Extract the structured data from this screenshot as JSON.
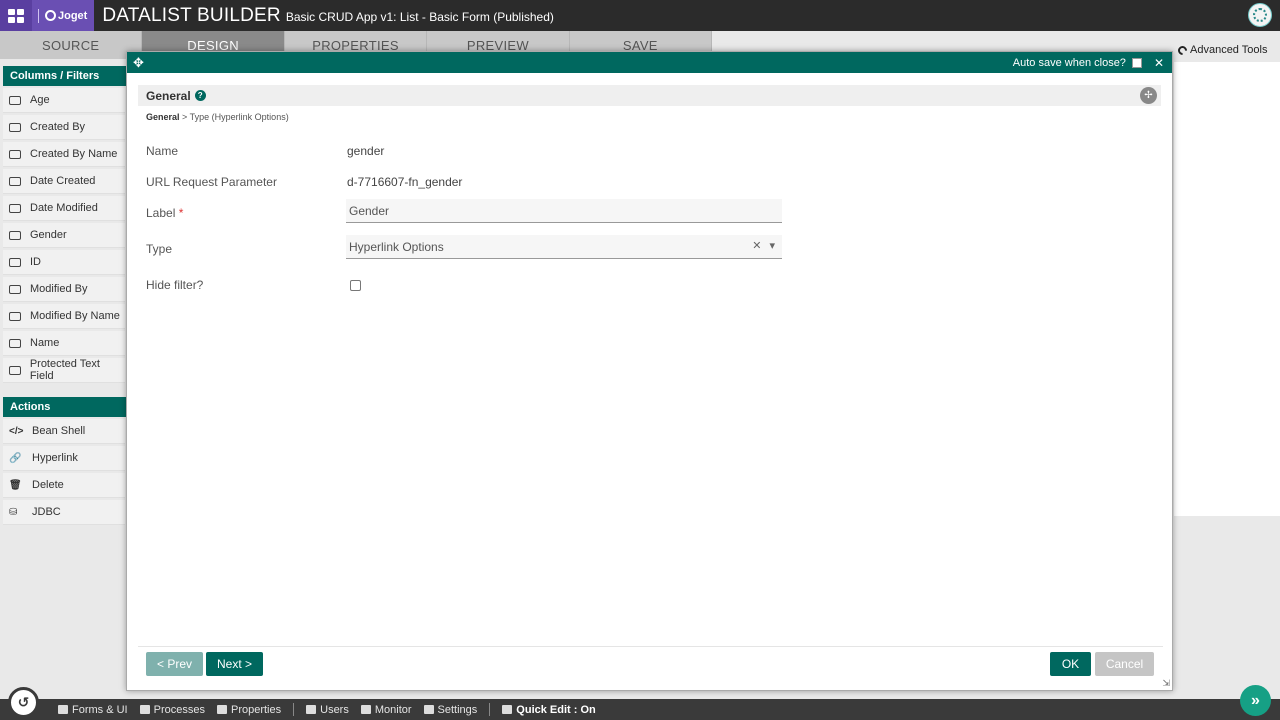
{
  "header": {
    "logo_text": "Joget",
    "builder_title": "DATALIST BUILDER",
    "builder_subtitle": "Basic CRUD App v1: List - Basic Form (Published)"
  },
  "tabs": [
    "SOURCE",
    "DESIGN",
    "PROPERTIES",
    "PREVIEW",
    "SAVE"
  ],
  "advanced_tools": "Advanced Tools",
  "sidebar": {
    "columns_header": "Columns / Filters",
    "columns": [
      "Age",
      "Created By",
      "Created By Name",
      "Date Created",
      "Date Modified",
      "Gender",
      "ID",
      "Modified By",
      "Modified By Name",
      "Name",
      "Protected Text Field"
    ],
    "actions_header": "Actions",
    "actions": [
      "Bean Shell",
      "Hyperlink",
      "Delete",
      "JDBC"
    ]
  },
  "modal": {
    "auto_save_label": "Auto save when close?",
    "section_title": "General",
    "breadcrumb_root": "General",
    "breadcrumb_sep": ">",
    "breadcrumb_leaf": "Type (Hyperlink Options)",
    "fields": {
      "name_label": "Name",
      "name_value": "gender",
      "url_param_label": "URL Request Parameter",
      "url_param_value": "d-7716607-fn_gender",
      "label_label": "Label",
      "label_required": "*",
      "label_value": "Gender",
      "type_label": "Type",
      "type_value": "Hyperlink Options",
      "hide_filter_label": "Hide filter?"
    },
    "buttons": {
      "prev": "< Prev",
      "next": "Next >",
      "ok": "OK",
      "cancel": "Cancel"
    }
  },
  "bottombar": {
    "items": [
      "Forms & UI",
      "Processes",
      "Properties",
      "Users",
      "Monitor",
      "Settings"
    ],
    "quick_edit": "Quick Edit : On"
  }
}
